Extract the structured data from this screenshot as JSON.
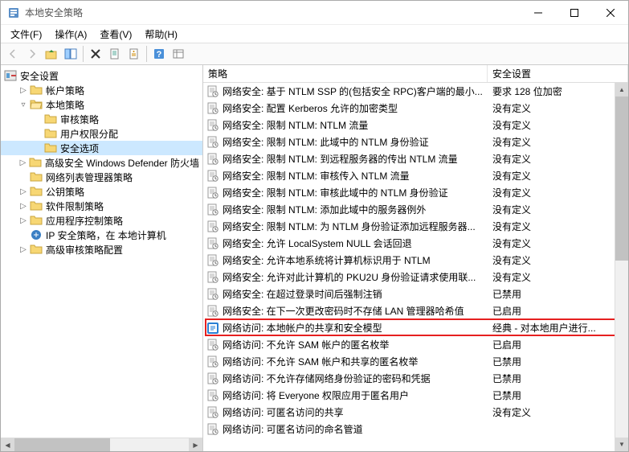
{
  "window": {
    "title": "本地安全策略"
  },
  "menus": [
    "文件(F)",
    "操作(A)",
    "查看(V)",
    "帮助(H)"
  ],
  "columns": {
    "policy": "策略",
    "setting": "安全设置"
  },
  "tree": {
    "root": "安全设置",
    "n_account": "帐户策略",
    "n_local": "本地策略",
    "n_audit": "审核策略",
    "n_userright": "用户权限分配",
    "n_secopt": "安全选项",
    "n_defender": "高级安全 Windows Defender 防火墙",
    "n_netlist": "网络列表管理器策略",
    "n_pubkey": "公钥策略",
    "n_software": "软件限制策略",
    "n_appctrl": "应用程序控制策略",
    "n_ipsec": "IP 安全策略，在 本地计算机",
    "n_advaudit": "高级审核策略配置"
  },
  "policies": [
    {
      "name": "网络安全: 基于 NTLM SSP 的(包括安全 RPC)客户端的最小...",
      "setting": "要求 128 位加密"
    },
    {
      "name": "网络安全: 配置 Kerberos 允许的加密类型",
      "setting": "没有定义"
    },
    {
      "name": "网络安全: 限制 NTLM: NTLM 流量",
      "setting": "没有定义"
    },
    {
      "name": "网络安全: 限制 NTLM: 此域中的 NTLM 身份验证",
      "setting": "没有定义"
    },
    {
      "name": "网络安全: 限制 NTLM: 到远程服务器的传出 NTLM 流量",
      "setting": "没有定义"
    },
    {
      "name": "网络安全: 限制 NTLM: 审核传入 NTLM 流量",
      "setting": "没有定义"
    },
    {
      "name": "网络安全: 限制 NTLM: 审核此域中的 NTLM 身份验证",
      "setting": "没有定义"
    },
    {
      "name": "网络安全: 限制 NTLM: 添加此域中的服务器例外",
      "setting": "没有定义"
    },
    {
      "name": "网络安全: 限制 NTLM: 为 NTLM 身份验证添加远程服务器...",
      "setting": "没有定义"
    },
    {
      "name": "网络安全: 允许 LocalSystem NULL 会话回退",
      "setting": "没有定义"
    },
    {
      "name": "网络安全: 允许本地系统将计算机标识用于 NTLM",
      "setting": "没有定义"
    },
    {
      "name": "网络安全: 允许对此计算机的 PKU2U 身份验证请求使用联...",
      "setting": "没有定义"
    },
    {
      "name": "网络安全: 在超过登录时间后强制注销",
      "setting": "已禁用"
    },
    {
      "name": "网络安全: 在下一次更改密码时不存储 LAN 管理器哈希值",
      "setting": "已启用"
    },
    {
      "name": "网络访问: 本地帐户的共享和安全模型",
      "setting": "经典 - 对本地用户进行...",
      "hl": true
    },
    {
      "name": "网络访问: 不允许 SAM 帐户的匿名枚举",
      "setting": "已启用"
    },
    {
      "name": "网络访问: 不允许 SAM 帐户和共享的匿名枚举",
      "setting": "已禁用"
    },
    {
      "name": "网络访问: 不允许存储网络身份验证的密码和凭据",
      "setting": "已禁用"
    },
    {
      "name": "网络访问: 将 Everyone 权限应用于匿名用户",
      "setting": "已禁用"
    },
    {
      "name": "网络访问: 可匿名访问的共享",
      "setting": "没有定义"
    },
    {
      "name": "网络访问: 可匿名访问的命名管道",
      "setting": ""
    }
  ]
}
